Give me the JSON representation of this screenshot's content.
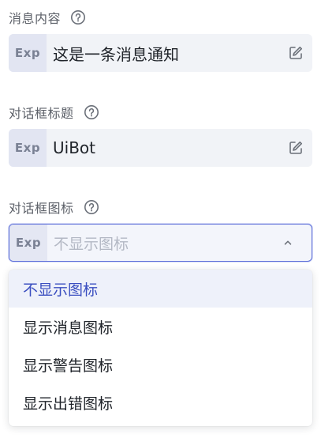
{
  "fields": [
    {
      "label": "消息内容",
      "prefix": "Exp",
      "value": "这是一条消息通知"
    },
    {
      "label": "对话框标题",
      "prefix": "Exp",
      "value": "UiBot"
    },
    {
      "label": "对话框图标",
      "prefix": "Exp",
      "placeholder": "不显示图标"
    }
  ],
  "dropdown": {
    "selected_index": 0,
    "options": [
      {
        "label": "不显示图标"
      },
      {
        "label": "显示消息图标"
      },
      {
        "label": "显示警告图标"
      },
      {
        "label": "显示出错图标"
      }
    ]
  },
  "icons": {
    "help": "question-circle-icon",
    "edit": "edit-pencil-icon",
    "chevron": "chevron-up-icon"
  },
  "colors": {
    "accent": "#3a4ec0",
    "focus_border": "#5d6fd9",
    "field_bg": "#f1f3f7",
    "prefix_bg": "#e2e5f2",
    "selected_option_bg": "#eef1fa"
  }
}
